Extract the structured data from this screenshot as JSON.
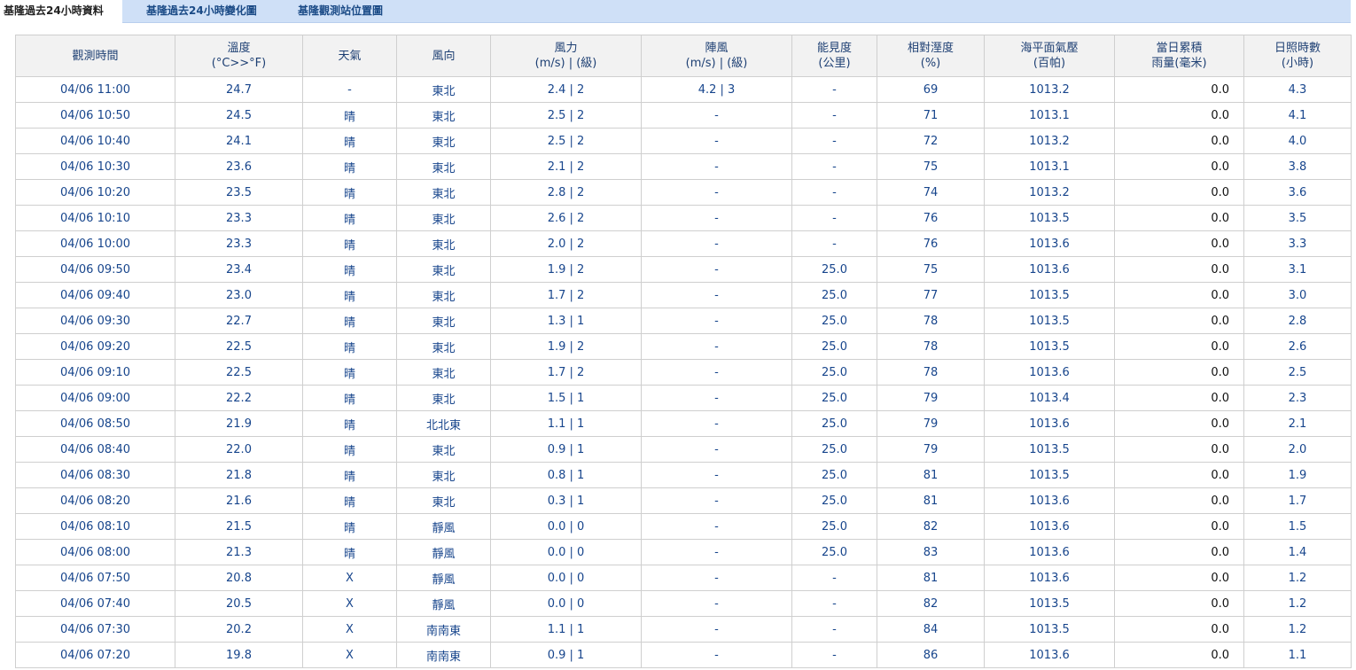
{
  "tabs": [
    {
      "label": "基隆過去24小時資料",
      "active": true
    },
    {
      "label": "基隆過去24小時變化圖",
      "active": false
    },
    {
      "label": "基隆觀測站位置圖",
      "active": false
    }
  ],
  "columns": [
    {
      "line1": "觀測時間",
      "line2": ""
    },
    {
      "line1": "溫度",
      "line2": "(°C>>°F)"
    },
    {
      "line1": "天氣",
      "line2": ""
    },
    {
      "line1": "風向",
      "line2": ""
    },
    {
      "line1": "風力",
      "line2": "(m/s) | (級)"
    },
    {
      "line1": "陣風",
      "line2": "(m/s) | (級)"
    },
    {
      "line1": "能見度",
      "line2": "(公里)"
    },
    {
      "line1": "相對溼度",
      "line2": "(%)"
    },
    {
      "line1": "海平面氣壓",
      "line2": "(百帕)"
    },
    {
      "line1": "當日累積",
      "line2": "雨量(毫米)"
    },
    {
      "line1": "日照時數",
      "line2": "(小時)"
    }
  ],
  "rows": [
    [
      "04/06 11:00",
      "24.7",
      "-",
      "東北",
      "2.4 | 2",
      "4.2 | 3",
      "-",
      "69",
      "1013.2",
      "0.0",
      "4.3"
    ],
    [
      "04/06 10:50",
      "24.5",
      "晴",
      "東北",
      "2.5 | 2",
      "-",
      "-",
      "71",
      "1013.1",
      "0.0",
      "4.1"
    ],
    [
      "04/06 10:40",
      "24.1",
      "晴",
      "東北",
      "2.5 | 2",
      "-",
      "-",
      "72",
      "1013.2",
      "0.0",
      "4.0"
    ],
    [
      "04/06 10:30",
      "23.6",
      "晴",
      "東北",
      "2.1 | 2",
      "-",
      "-",
      "75",
      "1013.1",
      "0.0",
      "3.8"
    ],
    [
      "04/06 10:20",
      "23.5",
      "晴",
      "東北",
      "2.8 | 2",
      "-",
      "-",
      "74",
      "1013.2",
      "0.0",
      "3.6"
    ],
    [
      "04/06 10:10",
      "23.3",
      "晴",
      "東北",
      "2.6 | 2",
      "-",
      "-",
      "76",
      "1013.5",
      "0.0",
      "3.5"
    ],
    [
      "04/06 10:00",
      "23.3",
      "晴",
      "東北",
      "2.0 | 2",
      "-",
      "-",
      "76",
      "1013.6",
      "0.0",
      "3.3"
    ],
    [
      "04/06 09:50",
      "23.4",
      "晴",
      "東北",
      "1.9 | 2",
      "-",
      "25.0",
      "75",
      "1013.6",
      "0.0",
      "3.1"
    ],
    [
      "04/06 09:40",
      "23.0",
      "晴",
      "東北",
      "1.7 | 2",
      "-",
      "25.0",
      "77",
      "1013.5",
      "0.0",
      "3.0"
    ],
    [
      "04/06 09:30",
      "22.7",
      "晴",
      "東北",
      "1.3 | 1",
      "-",
      "25.0",
      "78",
      "1013.5",
      "0.0",
      "2.8"
    ],
    [
      "04/06 09:20",
      "22.5",
      "晴",
      "東北",
      "1.9 | 2",
      "-",
      "25.0",
      "78",
      "1013.5",
      "0.0",
      "2.6"
    ],
    [
      "04/06 09:10",
      "22.5",
      "晴",
      "東北",
      "1.7 | 2",
      "-",
      "25.0",
      "78",
      "1013.6",
      "0.0",
      "2.5"
    ],
    [
      "04/06 09:00",
      "22.2",
      "晴",
      "東北",
      "1.5 | 1",
      "-",
      "25.0",
      "79",
      "1013.4",
      "0.0",
      "2.3"
    ],
    [
      "04/06 08:50",
      "21.9",
      "晴",
      "北北東",
      "1.1 | 1",
      "-",
      "25.0",
      "79",
      "1013.6",
      "0.0",
      "2.1"
    ],
    [
      "04/06 08:40",
      "22.0",
      "晴",
      "東北",
      "0.9 | 1",
      "-",
      "25.0",
      "79",
      "1013.5",
      "0.0",
      "2.0"
    ],
    [
      "04/06 08:30",
      "21.8",
      "晴",
      "東北",
      "0.8 | 1",
      "-",
      "25.0",
      "81",
      "1013.5",
      "0.0",
      "1.9"
    ],
    [
      "04/06 08:20",
      "21.6",
      "晴",
      "東北",
      "0.3 | 1",
      "-",
      "25.0",
      "81",
      "1013.6",
      "0.0",
      "1.7"
    ],
    [
      "04/06 08:10",
      "21.5",
      "晴",
      "靜風",
      "0.0 | 0",
      "-",
      "25.0",
      "82",
      "1013.6",
      "0.0",
      "1.5"
    ],
    [
      "04/06 08:00",
      "21.3",
      "晴",
      "靜風",
      "0.0 | 0",
      "-",
      "25.0",
      "83",
      "1013.6",
      "0.0",
      "1.4"
    ],
    [
      "04/06 07:50",
      "20.8",
      "X",
      "靜風",
      "0.0 | 0",
      "-",
      "-",
      "81",
      "1013.6",
      "0.0",
      "1.2"
    ],
    [
      "04/06 07:40",
      "20.5",
      "X",
      "靜風",
      "0.0 | 0",
      "-",
      "-",
      "82",
      "1013.5",
      "0.0",
      "1.2"
    ],
    [
      "04/06 07:30",
      "20.2",
      "X",
      "南南東",
      "1.1 | 1",
      "-",
      "-",
      "84",
      "1013.5",
      "0.0",
      "1.2"
    ],
    [
      "04/06 07:20",
      "19.8",
      "X",
      "南南東",
      "0.9 | 1",
      "-",
      "-",
      "86",
      "1013.6",
      "0.0",
      "1.1"
    ]
  ]
}
